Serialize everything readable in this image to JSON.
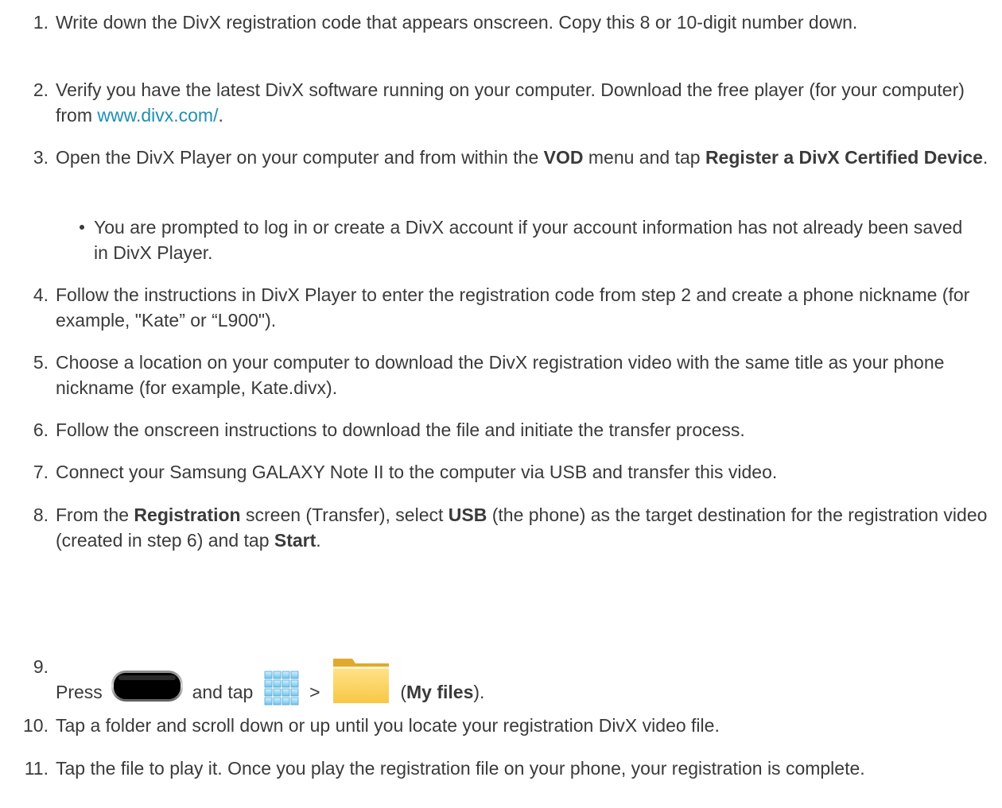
{
  "steps": [
    {
      "num": "1.",
      "text_a": "Write down the DivX registration code that appears onscreen. Copy this 8 or 10-digit number down."
    },
    {
      "num": "2.",
      "text_a": "Verify you have the latest DivX software running on your computer. Download the free player (for your computer) from ",
      "link": "www.divx.com/",
      "text_b": "."
    },
    {
      "num": "3.",
      "text_a": "Open the DivX Player on your computer and from within the ",
      "bold_1": "VOD",
      "text_b": " menu and tap ",
      "bold_2": "Register a DivX Certified Device",
      "text_c": "."
    },
    {
      "num": "4.",
      "text_a": "Follow the instructions in DivX Player to enter the registration code from step 2 and create a phone nickname (for example, \"Kate” or “L900\")."
    },
    {
      "num": "5.",
      "text_a": "Choose a location on your computer to download the DivX registration video with the same title as your phone nickname (for example, Kate.divx)."
    },
    {
      "num": "6.",
      "text_a": "Follow the onscreen instructions to download the file and initiate the transfer process."
    },
    {
      "num": "7.",
      "text_a": "Connect your Samsung GALAXY Note II to the computer via USB and transfer this video."
    },
    {
      "num": "8.",
      "text_a": "From the ",
      "bold_1": "Registration",
      "text_b": " screen (Transfer), select ",
      "bold_2": "USB",
      "text_c": " (the phone) as the target destination for the registration video (created in step 6) and tap ",
      "bold_3": "Start",
      "text_d": "."
    },
    {
      "num": "9.",
      "text_a": "Press",
      "text_b": "and tap",
      "text_c": ">",
      "text_d": "(",
      "bold_1": "My files",
      "text_e": ")."
    },
    {
      "num": "10.",
      "text_a": "Tap a folder and scroll down or up until you locate your registration DivX video file."
    },
    {
      "num": "11.",
      "text_a": "Tap the file to play it. Once you play the registration file on your phone, your registration is complete."
    }
  ],
  "bullet": {
    "text": "You are prompted to log in or create a DivX account if your account information has not already been saved in DivX Player."
  },
  "icons": {
    "home_key": "home-key-icon",
    "apps": "apps-icon",
    "folder": "folder-icon"
  },
  "colors": {
    "text": "#3a3a3a",
    "link": "#1f8fb3"
  }
}
